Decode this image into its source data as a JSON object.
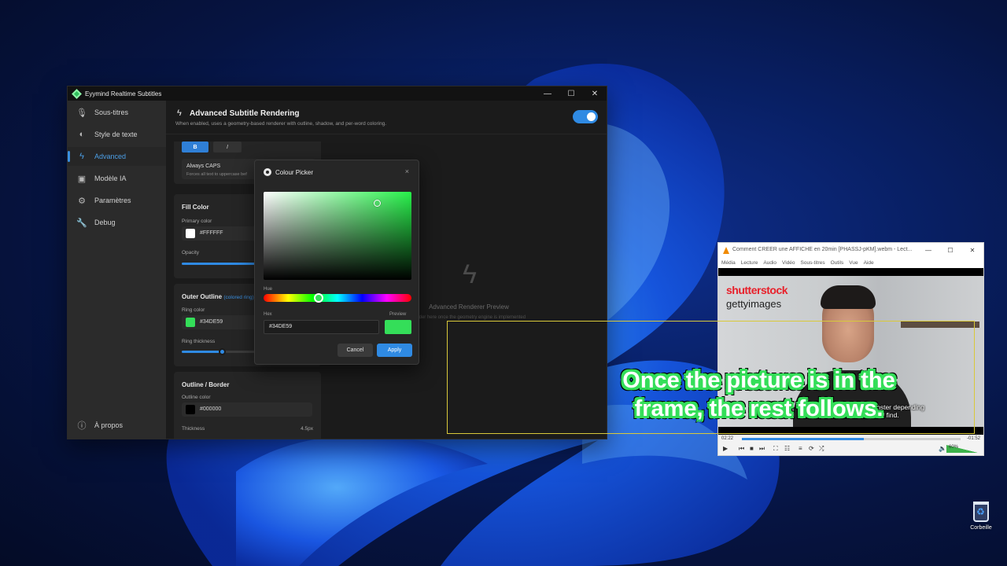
{
  "app": {
    "title": "Eyymind Realtime Subtitles",
    "controls": {
      "minimize": "—",
      "maximize": "☐",
      "close": "✕"
    },
    "sidebar": {
      "items": [
        {
          "label": "Sous-titres",
          "icon": "microphone-icon",
          "active": false
        },
        {
          "label": "Style de texte",
          "icon": "palette-icon",
          "active": false
        },
        {
          "label": "Advanced",
          "icon": "bolt-icon",
          "active": true
        },
        {
          "label": "Modèle IA",
          "icon": "chip-icon",
          "active": false
        },
        {
          "label": "Paramètres",
          "icon": "gear-icon",
          "active": false
        },
        {
          "label": "Debug",
          "icon": "wrench-icon",
          "active": false
        }
      ],
      "about": "À propos"
    },
    "header": {
      "title": "Advanced Subtitle Rendering",
      "description": "When enabled, uses a geometry-based renderer with outline, shadow, and per-word coloring.",
      "enabled": true
    },
    "style": {
      "bold_label": "B",
      "italic_label": "I",
      "caps_title": "Always CAPS",
      "caps_desc": "Forces all text to uppercase bef"
    },
    "fill": {
      "title": "Fill Color",
      "primary_label": "Primary color",
      "primary_hex": "#FFFFFF",
      "opacity_label": "Opacity"
    },
    "outer_outline": {
      "title": "Outer Outline",
      "note": "(colored ring)",
      "ring_label": "Ring color",
      "ring_hex": "#34DE59",
      "thickness_label": "Ring thickness"
    },
    "outline": {
      "title": "Outline / Border",
      "color_label": "Outline color",
      "color_hex": "#000000",
      "thickness_label": "Thickness",
      "thickness_value": "4.5px"
    },
    "preview": {
      "title": "Advanced Renderer Preview",
      "description": "render here once the geometry engine is implemented"
    }
  },
  "picker": {
    "title": "Colour Picker",
    "close": "×",
    "hue_label": "Hue",
    "hex_label": "Hex",
    "preview_label": "Preview",
    "hex_value": "#34DE59",
    "cancel": "Cancel",
    "apply": "Apply"
  },
  "vlc": {
    "title": "Comment CREER une AFFICHE en 20min [PHASSJ-pKM].webm - Lect...",
    "controls": {
      "minimize": "—",
      "maximize": "☐",
      "close": "✕"
    },
    "menu": [
      "Média",
      "Lecture",
      "Audio",
      "Vidéo",
      "Sous-titres",
      "Outils",
      "Vue",
      "Aide"
    ],
    "brand_1": "shutterstock",
    "brand_2": "gettyimages",
    "subtitle_line1": "little your poster depending",
    "subtitle_line2": "at you will find.",
    "time_elapsed": "02:22",
    "time_remaining": "-01:52",
    "volume": "60%"
  },
  "overlay": {
    "line1": "Once the picture is in the",
    "line2": "frame, the rest follows."
  },
  "desktop": {
    "recycle_bin": "Corbeille"
  },
  "colors": {
    "accent": "#2f8ae3",
    "ring": "#34DE59",
    "fill": "#FFFFFF",
    "outline": "#000000"
  }
}
